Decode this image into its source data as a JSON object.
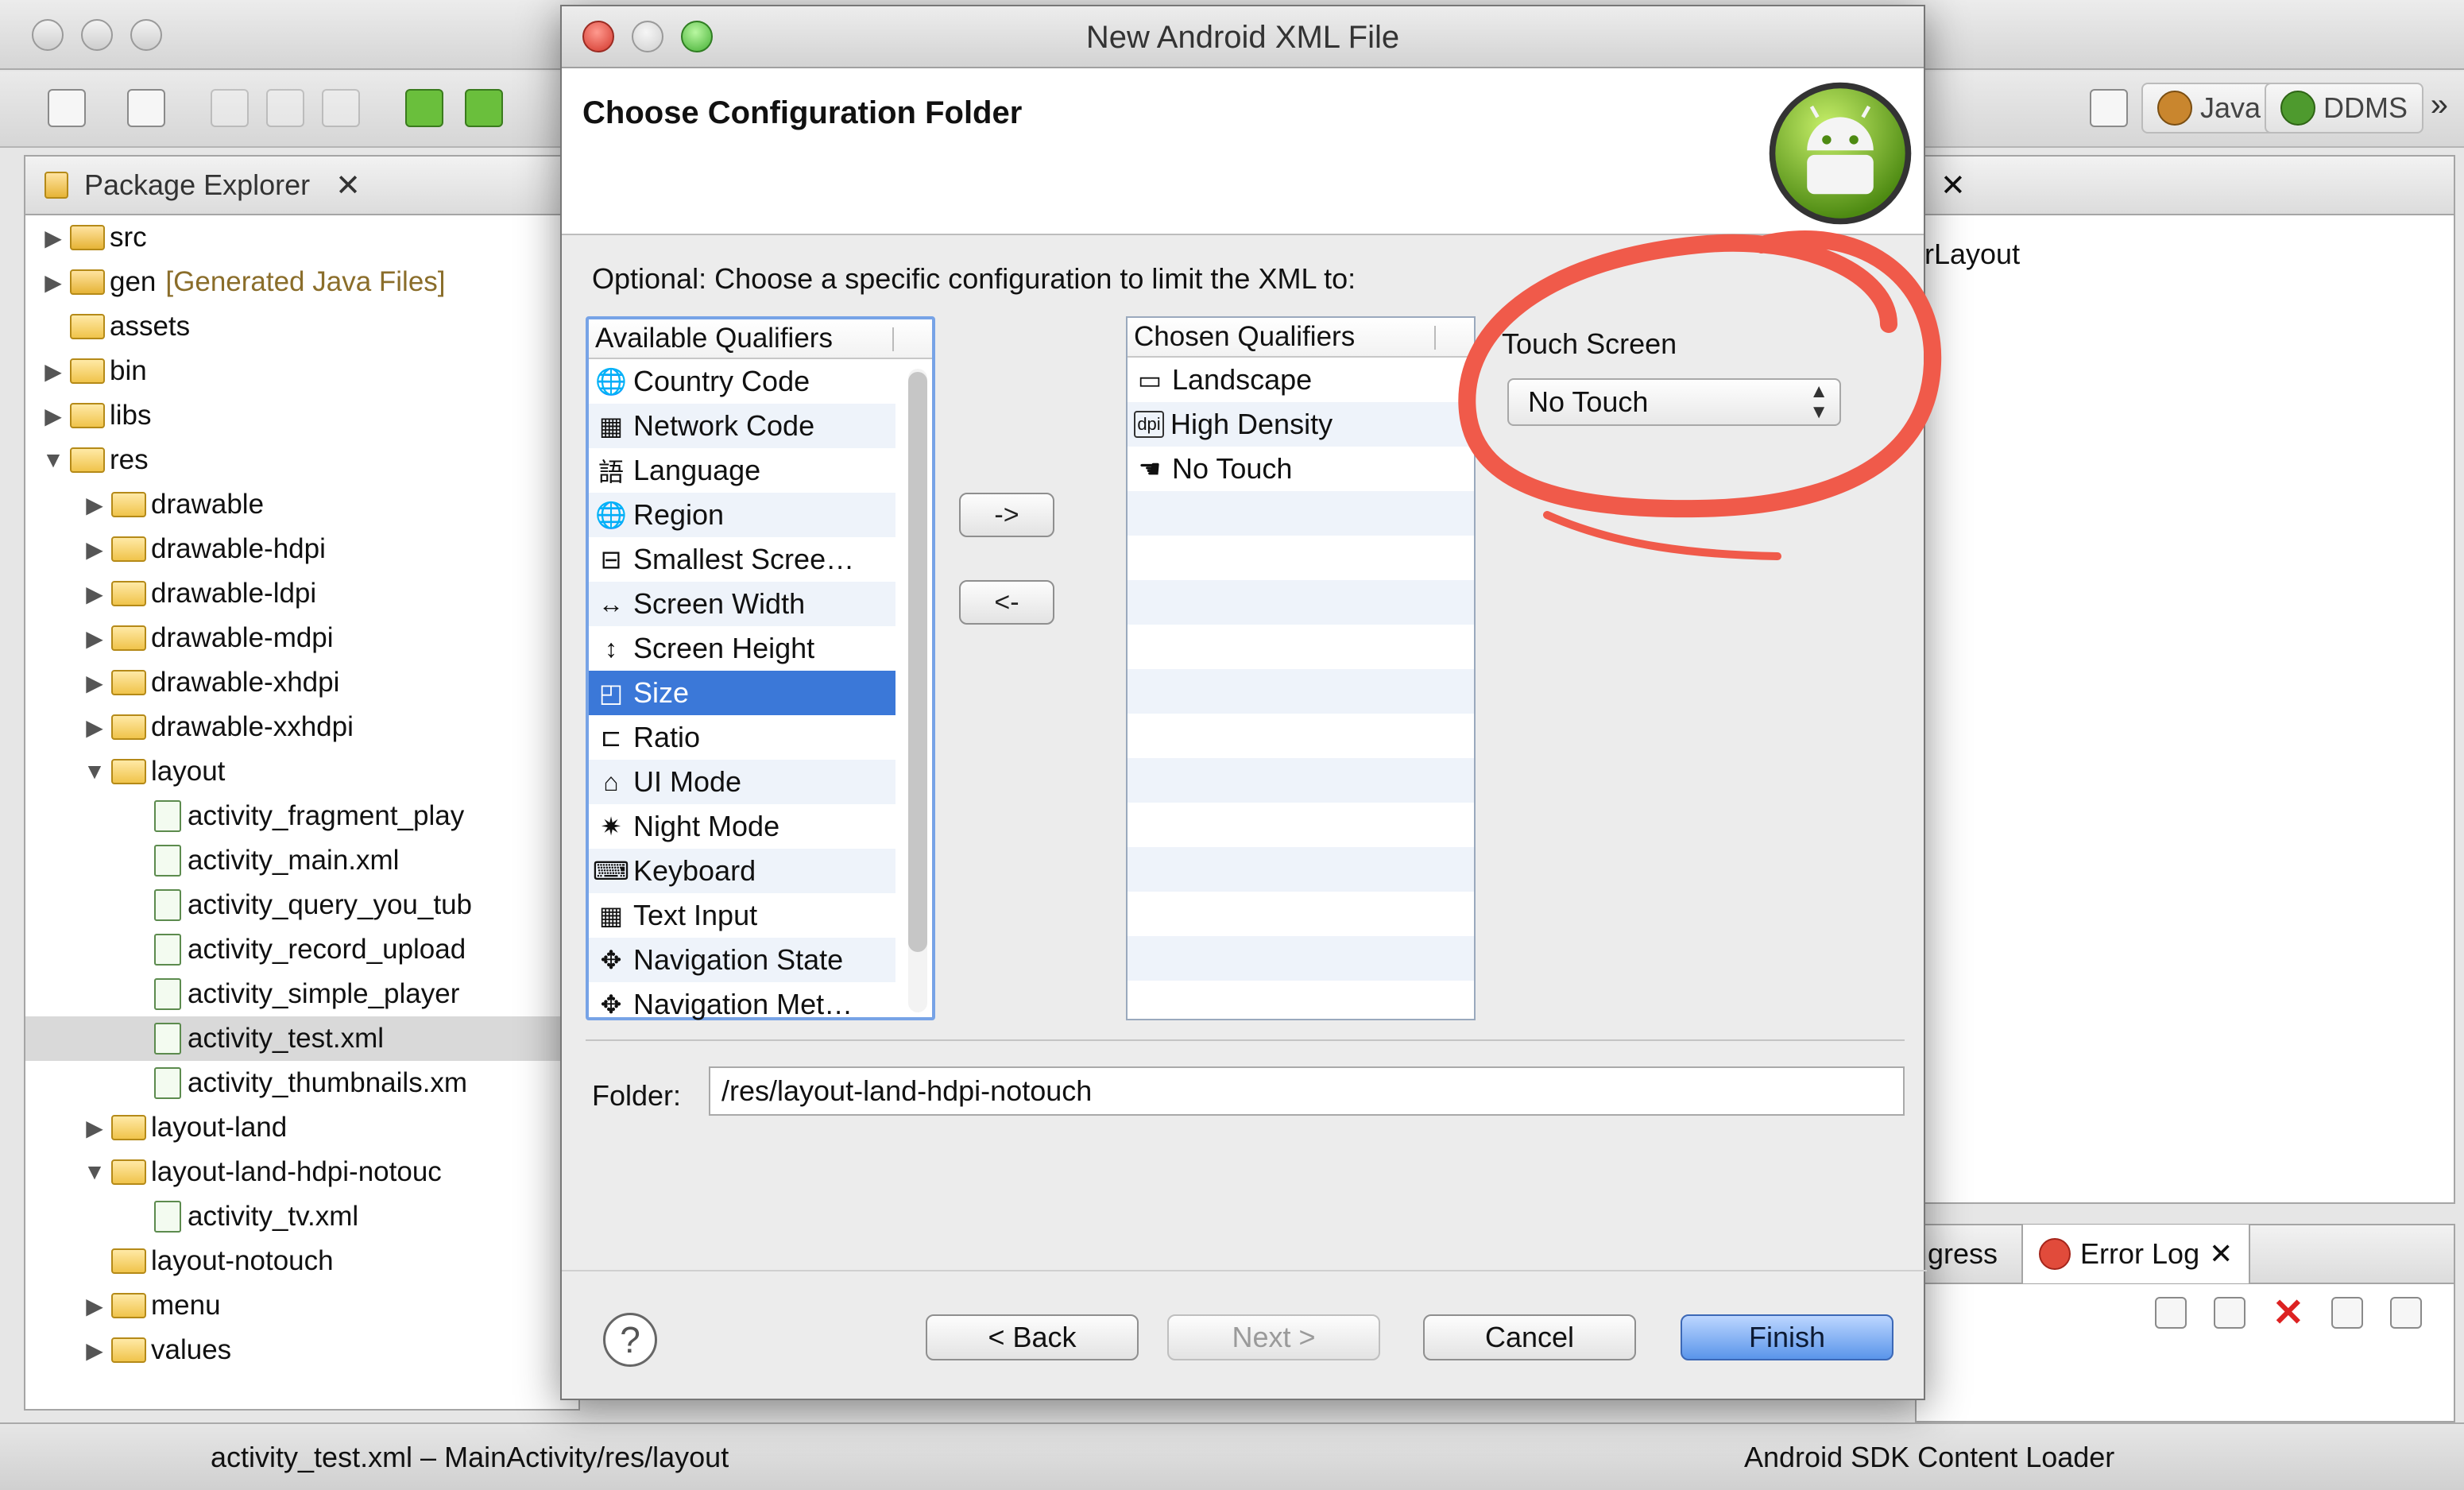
{
  "eclipse": {
    "perspectives": [
      {
        "label": "Java",
        "icon": "java-perspective-icon"
      },
      {
        "label": "DDMS",
        "icon": "ddms-icon"
      }
    ],
    "package_explorer": {
      "title": "Package Explorer",
      "tree": [
        {
          "label": "src",
          "indent": 1,
          "toggle": "▶",
          "kind": "pkg"
        },
        {
          "label": "gen",
          "extra": "[Generated Java Files]",
          "indent": 1,
          "toggle": "▶",
          "kind": "pkg"
        },
        {
          "label": "assets",
          "indent": 1,
          "toggle": "",
          "kind": "folder"
        },
        {
          "label": "bin",
          "indent": 1,
          "toggle": "▶",
          "kind": "folder"
        },
        {
          "label": "libs",
          "indent": 1,
          "toggle": "▶",
          "kind": "folder"
        },
        {
          "label": "res",
          "indent": 1,
          "toggle": "▼",
          "kind": "folder"
        },
        {
          "label": "drawable",
          "indent": 2,
          "toggle": "▶",
          "kind": "folder"
        },
        {
          "label": "drawable-hdpi",
          "indent": 2,
          "toggle": "▶",
          "kind": "folder"
        },
        {
          "label": "drawable-ldpi",
          "indent": 2,
          "toggle": "▶",
          "kind": "folder"
        },
        {
          "label": "drawable-mdpi",
          "indent": 2,
          "toggle": "▶",
          "kind": "folder"
        },
        {
          "label": "drawable-xhdpi",
          "indent": 2,
          "toggle": "▶",
          "kind": "folder"
        },
        {
          "label": "drawable-xxhdpi",
          "indent": 2,
          "toggle": "▶",
          "kind": "folder"
        },
        {
          "label": "layout",
          "indent": 2,
          "toggle": "▼",
          "kind": "folder"
        },
        {
          "label": "activity_fragment_play",
          "indent": 3,
          "toggle": "",
          "kind": "xml"
        },
        {
          "label": "activity_main.xml",
          "indent": 3,
          "toggle": "",
          "kind": "xml"
        },
        {
          "label": "activity_query_you_tub",
          "indent": 3,
          "toggle": "",
          "kind": "xml"
        },
        {
          "label": "activity_record_upload",
          "indent": 3,
          "toggle": "",
          "kind": "xml"
        },
        {
          "label": "activity_simple_player",
          "indent": 3,
          "toggle": "",
          "kind": "xml"
        },
        {
          "label": "activity_test.xml",
          "indent": 3,
          "toggle": "",
          "kind": "xml",
          "selected": true
        },
        {
          "label": "activity_thumbnails.xm",
          "indent": 3,
          "toggle": "",
          "kind": "xml"
        },
        {
          "label": "layout-land",
          "indent": 2,
          "toggle": "▶",
          "kind": "folder"
        },
        {
          "label": "layout-land-hdpi-notouc",
          "indent": 2,
          "toggle": "▼",
          "kind": "folder"
        },
        {
          "label": "activity_tv.xml",
          "indent": 3,
          "toggle": "",
          "kind": "xml"
        },
        {
          "label": "layout-notouch",
          "indent": 2,
          "toggle": "",
          "kind": "folder"
        },
        {
          "label": "menu",
          "indent": 2,
          "toggle": "▶",
          "kind": "folder"
        },
        {
          "label": "values",
          "indent": 2,
          "toggle": "▶",
          "kind": "folder"
        }
      ]
    },
    "outline_text": "rLayout",
    "bottom_tabs": {
      "progress_partial": "gress",
      "error_log": "Error Log"
    },
    "status": {
      "left": "activity_test.xml – MainActivity/res/layout",
      "right": "Android SDK Content Loader"
    }
  },
  "dialog": {
    "title": "New Android XML File",
    "heading": "Choose Configuration Folder",
    "optional_text": "Optional: Choose a specific configuration to limit the XML to:",
    "available_header": "Available Qualifiers",
    "available": [
      {
        "label": "Country Code",
        "icon": "country-code-icon",
        "glyph": "🌐"
      },
      {
        "label": "Network Code",
        "icon": "network-code-icon",
        "glyph": "▦"
      },
      {
        "label": "Language",
        "icon": "language-icon",
        "glyph": "語"
      },
      {
        "label": "Region",
        "icon": "region-icon",
        "glyph": "🌐"
      },
      {
        "label": "Smallest Scree…",
        "icon": "smallest-screen-icon",
        "glyph": "⊟"
      },
      {
        "label": "Screen Width",
        "icon": "screen-width-icon",
        "glyph": "↔"
      },
      {
        "label": "Screen Height",
        "icon": "screen-height-icon",
        "glyph": "↕"
      },
      {
        "label": "Size",
        "icon": "size-icon",
        "glyph": "◰",
        "selected": true
      },
      {
        "label": "Ratio",
        "icon": "ratio-icon",
        "glyph": "⊏"
      },
      {
        "label": "UI Mode",
        "icon": "ui-mode-icon",
        "glyph": "⌂"
      },
      {
        "label": "Night Mode",
        "icon": "night-mode-icon",
        "glyph": "✷"
      },
      {
        "label": "Keyboard",
        "icon": "keyboard-icon",
        "glyph": "⌨"
      },
      {
        "label": "Text Input",
        "icon": "text-input-icon",
        "glyph": "▦"
      },
      {
        "label": "Navigation State",
        "icon": "navigation-state-icon",
        "glyph": "✥"
      },
      {
        "label": "Navigation Met…",
        "icon": "navigation-method-icon",
        "glyph": "✥"
      }
    ],
    "chosen_header": "Chosen Qualifiers",
    "chosen": [
      {
        "label": "Landscape",
        "icon": "landscape-icon",
        "glyph": "▭"
      },
      {
        "label": "High Density",
        "icon": "high-density-icon",
        "glyph": "dpi"
      },
      {
        "label": "No Touch",
        "icon": "no-touch-icon",
        "glyph": "☚"
      }
    ],
    "add_label": "->",
    "remove_label": "<-",
    "touch_label": "Touch Screen",
    "touch_value": "No Touch",
    "folder_label": "Folder:",
    "folder_value": "/res/layout-land-hdpi-notouch",
    "help_label": "?",
    "back_label": "< Back",
    "next_label": "Next >",
    "cancel_label": "Cancel",
    "finish_label": "Finish",
    "annotation_color": "#f05a4a"
  }
}
